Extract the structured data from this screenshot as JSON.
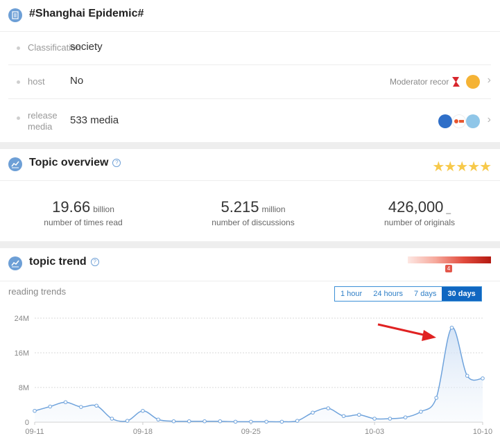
{
  "topic": {
    "title": "#Shanghai Epidemic#",
    "rows": [
      {
        "label": "Classification",
        "value": "society"
      },
      {
        "label": "host",
        "value": "No",
        "right_label": "Moderator record"
      },
      {
        "label": "release media",
        "value": "533 media"
      }
    ]
  },
  "overview": {
    "title": "Topic overview",
    "stars": "★★★★★",
    "stats": [
      {
        "number": "19.66",
        "unit": "billion",
        "label": "number of times read"
      },
      {
        "number": "5.215",
        "unit": "million",
        "label": "number of discussions"
      },
      {
        "number": "426,000",
        "unit": "_",
        "label": "number of originals"
      }
    ]
  },
  "trend": {
    "title": "topic trend",
    "heat_level": "4",
    "sub_label": "reading trends",
    "tabs": [
      "1 hour",
      "24 hours",
      "7 days",
      "30 days"
    ],
    "active_tab": "30 days"
  },
  "colors": {
    "accent": "#1067c1",
    "line": "#6fa3dc",
    "star": "#f7c94a",
    "arrow": "#e02222"
  },
  "icons": [
    "document-icon",
    "chart-icon",
    "help-icon",
    "chevron-right-icon",
    "star-icon"
  ],
  "chart_data": {
    "type": "area",
    "x": [
      "09-11",
      "09-12",
      "09-13",
      "09-14",
      "09-15",
      "09-16",
      "09-17",
      "09-18",
      "09-19",
      "09-20",
      "09-21",
      "09-22",
      "09-23",
      "09-24",
      "09-25",
      "09-26",
      "09-27",
      "09-28",
      "09-29",
      "09-30",
      "10-01",
      "10-02",
      "10-03",
      "10-04",
      "10-05",
      "10-06",
      "10-07",
      "10-08",
      "10-09",
      "10-10"
    ],
    "values": [
      2.6,
      3.6,
      4.6,
      3.5,
      3.8,
      0.8,
      0.3,
      2.6,
      0.6,
      0.2,
      0.2,
      0.2,
      0.2,
      0.1,
      0.1,
      0.1,
      0.1,
      0.3,
      2.2,
      3.2,
      1.4,
      1.7,
      0.8,
      0.8,
      1.1,
      2.4,
      5.6,
      21.8,
      10.7,
      10.1
    ],
    "x_ticks": [
      "09-11",
      "09-18",
      "09-25",
      "10-03",
      "10-10"
    ],
    "y_ticks": [
      "0",
      "8M",
      "16M",
      "24M"
    ],
    "ylim": [
      0,
      24
    ],
    "grid": true
  }
}
